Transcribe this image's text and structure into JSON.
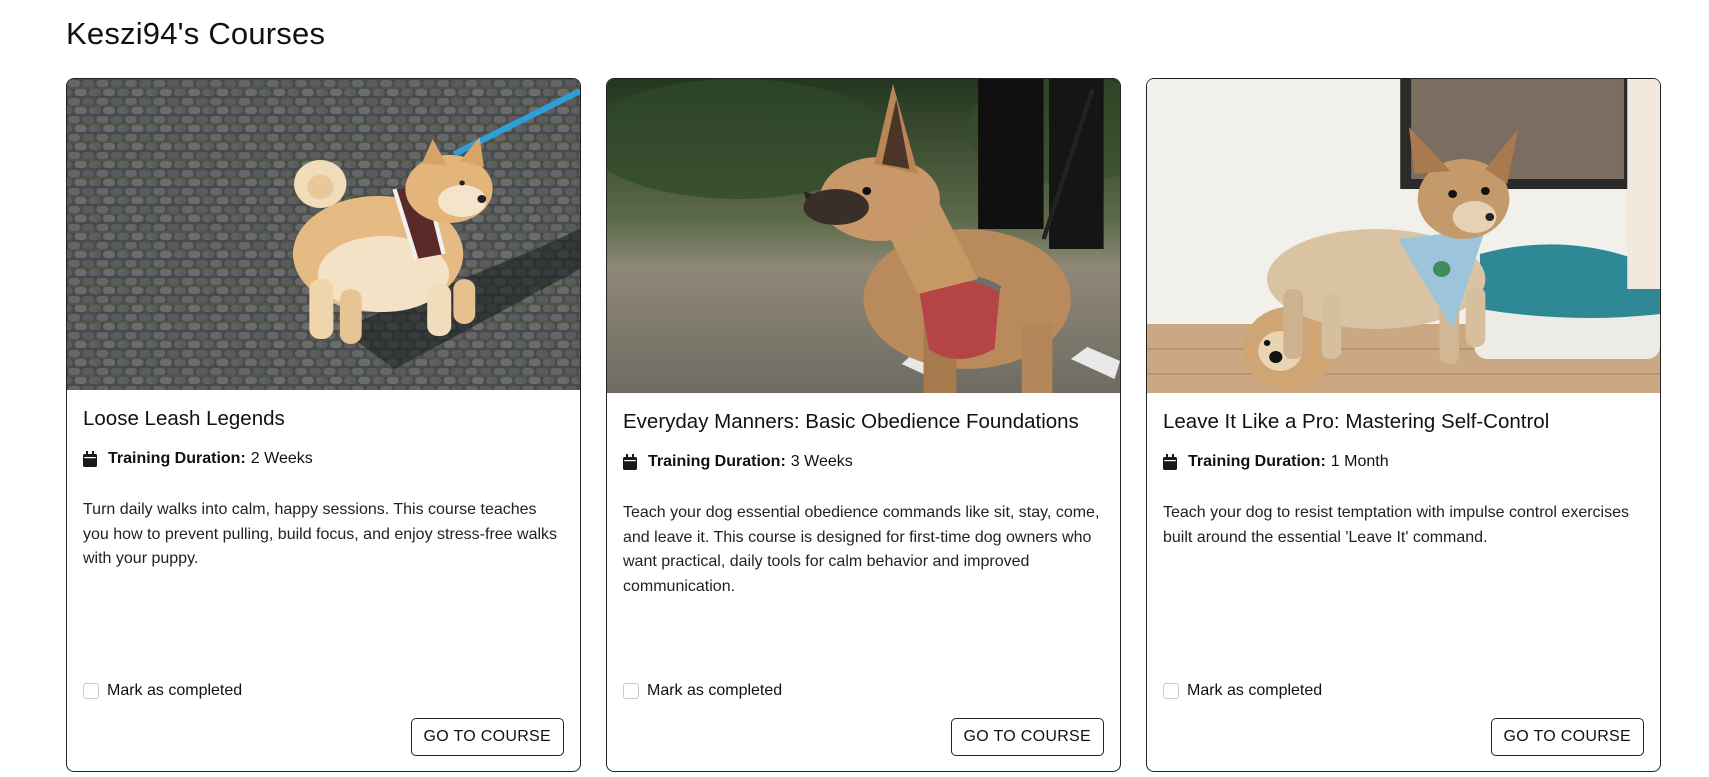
{
  "page": {
    "title": "Keszi94's Courses"
  },
  "courses": [
    {
      "title": "Loose Leash Legends",
      "duration_label": "Training Duration:",
      "duration_value": "2 Weeks",
      "description": "Turn daily walks into calm, happy sessions. This course teaches you how to prevent pulling, build focus, and enjoy stress-free walks with your puppy.",
      "completed_label": "Mark as completed",
      "button_label": "GO TO COURSE",
      "image_alt": "Akita puppy on leash on cobblestones"
    },
    {
      "title": "Everyday Manners: Basic Obedience Foundations",
      "duration_label": "Training Duration:",
      "duration_value": "3 Weeks",
      "description": "Teach your dog essential obedience commands like sit, stay, come, and leave it. This course is designed for first-time dog owners who want practical, daily tools for calm behavior and improved communication.",
      "completed_label": "Mark as completed",
      "button_label": "GO TO COURSE",
      "image_alt": "Shepherd mix dog in red harness"
    },
    {
      "title": "Leave It Like a Pro: Mastering Self-Control",
      "duration_label": "Training Duration:",
      "duration_value": "1 Month",
      "description": "Teach your dog to resist temptation with impulse control exercises built around the essential 'Leave It' command.",
      "completed_label": "Mark as completed",
      "button_label": "GO TO COURSE",
      "image_alt": "Small fluffy dog in blue bandana next to toy"
    }
  ]
}
